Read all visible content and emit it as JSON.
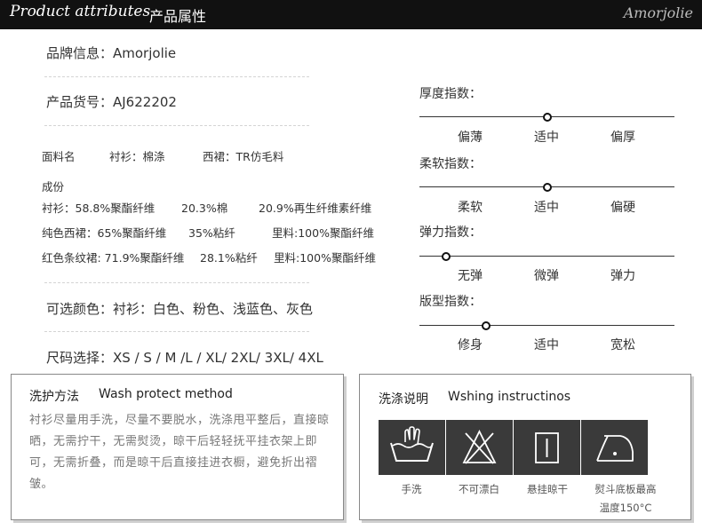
{
  "header": {
    "title_en": "Product attributes",
    "title_cn": "产品属性",
    "brand_logo": "Amorjolie"
  },
  "brand": "品牌信息：Amorjolie",
  "item_no": "产品货号：AJ622202",
  "fabric": {
    "label": "面料名",
    "shirt": "衬衫：棉涤",
    "skirt": "西裙：TR仿毛料"
  },
  "composition": {
    "label": "成份",
    "rows": [
      [
        "衬衫：58.8%聚酯纤维",
        "20.3%棉",
        "20.9%再生纤维素纤维"
      ],
      [
        "纯色西裙：65%聚酯纤维",
        "35%粘纤",
        "里料:100%聚酯纤维"
      ],
      [
        "红色条纹裙: 71.9%聚酯纤维",
        "28.1%粘纤",
        "里料:100%聚酯纤维"
      ]
    ]
  },
  "colors": "可选颜色：衬衫：白色、粉色、浅蓝色、灰色",
  "sizes": "尺码选择：XS / S / M  /L / XL/  2XL/  3XL/  4XL",
  "meters": [
    {
      "title": "厚度指数：",
      "labels": [
        "偏薄",
        "适中",
        "偏厚"
      ],
      "level": 0.5
    },
    {
      "title": "柔软指数：",
      "labels": [
        "柔软",
        "适中",
        "偏硬"
      ],
      "level": 0.5
    },
    {
      "title": "弹力指数：",
      "labels": [
        "无弹",
        "微弹",
        "弹力"
      ],
      "level": 0
    },
    {
      "title": "版型指数：",
      "labels": [
        "修身",
        "适中",
        "宽松"
      ],
      "level": 0.2
    }
  ],
  "wash_method": {
    "title_cn": "洗护方法",
    "title_en": "Wash protect method",
    "text": "衬衫尽量用手洗，尽量不要脱水，洗涤甩平整后，直接晾晒，无需拧干，无需熨烫，晾干后轻轻抚平挂衣架上即可，无需折叠，而是晾干后直接挂进衣橱，避免折出褶皱。"
  },
  "wash_instructions": {
    "title_cn": "洗涤说明",
    "title_en": "Wshing instructinos",
    "items": [
      {
        "icon": "hand-wash-icon",
        "label": "手洗"
      },
      {
        "icon": "no-bleach-icon",
        "label": "不可漂白"
      },
      {
        "icon": "hang-dry-icon",
        "label": "悬挂晾干"
      },
      {
        "icon": "iron-icon",
        "label": "熨斗底板最高",
        "label2": "温度150°C"
      }
    ]
  },
  "colors_theme": {
    "header_bg": "#111111",
    "icon_bg": "#3a3a3a",
    "text": "#333333"
  }
}
